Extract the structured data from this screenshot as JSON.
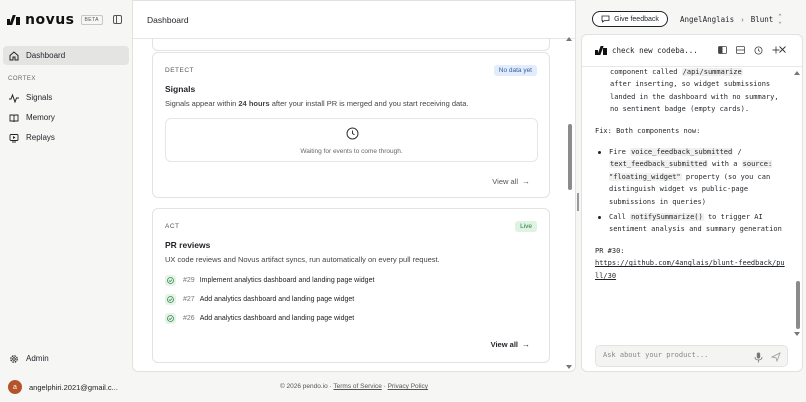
{
  "app": {
    "logo_text": "novus",
    "beta_label": "BETA"
  },
  "sidebar": {
    "items": [
      {
        "label": "Dashboard",
        "icon": "home-icon",
        "active": true
      },
      {
        "label": "Signals",
        "icon": "pulse-icon"
      },
      {
        "label": "Memory",
        "icon": "book-icon"
      },
      {
        "label": "Replays",
        "icon": "replay-icon"
      }
    ],
    "section_label": "CORTEX",
    "admin_label": "Admin",
    "user": {
      "initial": "a",
      "email": "angelphiri.2021@gmail.c..."
    }
  },
  "main": {
    "title": "Dashboard",
    "signals_card": {
      "kicker": "DETECT",
      "badge": "No data yet",
      "title": "Signals",
      "desc_before": "Signals appear within ",
      "desc_bold": "24 hours",
      "desc_after": " after your install PR is merged and you start receiving data.",
      "empty_text": "Waiting for events to come through.",
      "view_all": "View all"
    },
    "act_card": {
      "kicker": "ACT",
      "badge": "Live",
      "title": "PR reviews",
      "desc": "UX code reviews and Novus artifact syncs, run automatically on every pull request.",
      "prs": [
        {
          "num": "#29",
          "title": "Implement analytics dashboard and landing page widget"
        },
        {
          "num": "#27",
          "title": "Add analytics dashboard and landing page widget"
        },
        {
          "num": "#26",
          "title": "Add analytics dashboard and landing page widget"
        }
      ],
      "view_all": "View all"
    }
  },
  "footer": {
    "copyright": "© 2026 pendo.io · ",
    "terms": "Terms of Service",
    "sep": " · ",
    "privacy": "Privacy Policy"
  },
  "topbar": {
    "feedback_label": "Give feedback",
    "org": "AngelAnglais",
    "project": "Blunt"
  },
  "chat": {
    "title": "check new codeba...",
    "lines": {
      "l1_pre": "component called ",
      "l1_code": "/api/summarize",
      "l2": "after inserting, so widget submissions landed in the dashboard with no summary, no sentiment badge (empty cards).",
      "fix": "Fix: Both components now:",
      "b1_pre": "Fire ",
      "b1_code1": "voice_feedback_submitted",
      "b1_sep": " / ",
      "b1_code2": "text_feedback_submitted",
      "b1_mid": " with a ",
      "b1_code3": "source: \"floating_widget\"",
      "b1_post": " property (so you can distinguish widget vs public-page submissions in queries)",
      "b2_pre": "Call ",
      "b2_code": "notifySummarize()",
      "b2_post": " to trigger AI sentiment analysis and summary generation",
      "pr_label": "PR #30:",
      "pr_link": "https://github.com/4anglais/blunt-feedback/pull/30"
    },
    "input_placeholder": "Ask about your product..."
  }
}
